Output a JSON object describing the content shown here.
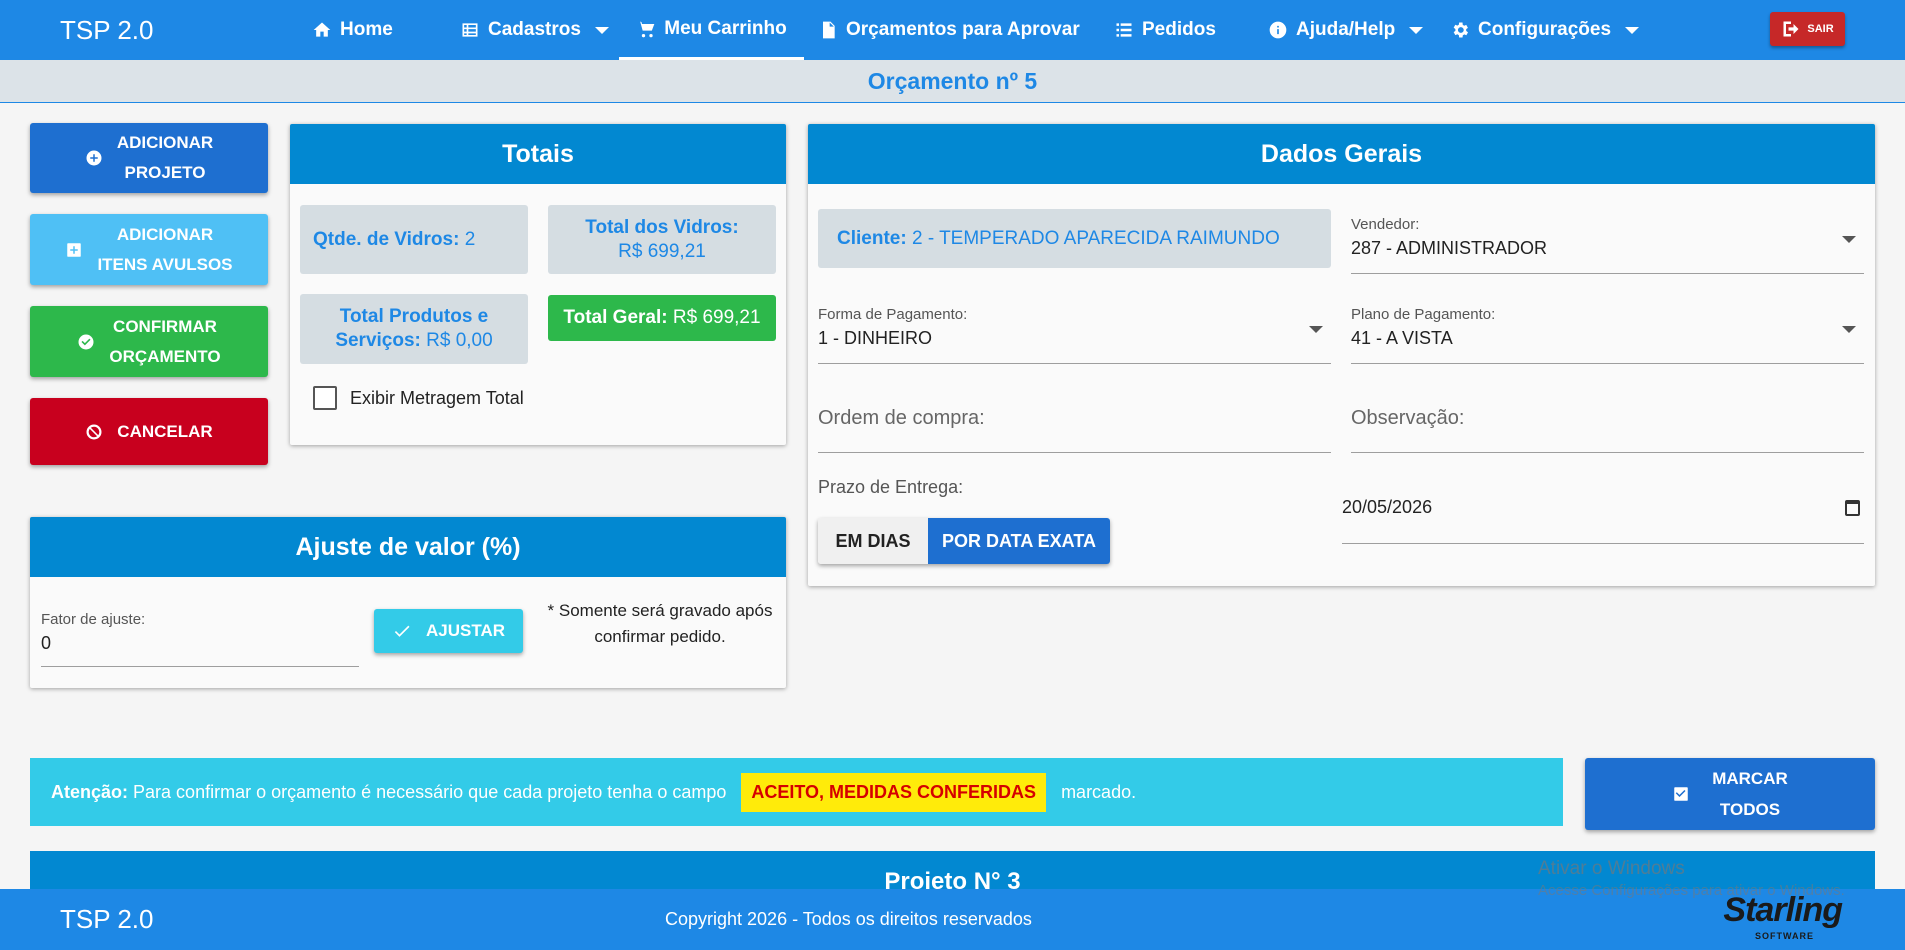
{
  "app": {
    "title": "TSP 2.0"
  },
  "nav": {
    "home": "Home",
    "cadastros": "Cadastros",
    "carrinho": "Meu Carrinho",
    "orcamentos": "Orçamentos para Aprovar",
    "pedidos": "Pedidos",
    "ajuda": "Ajuda/Help",
    "config": "Configurações",
    "sair": "SAIR"
  },
  "page": {
    "title": "Orçamento nº 5"
  },
  "actions": {
    "add_project_1": "ADICIONAR",
    "add_project_2": "PROJETO",
    "add_items_1": "ADICIONAR",
    "add_items_2": "ITENS AVULSOS",
    "confirm_1": "CONFIRMAR",
    "confirm_2": "ORÇAMENTO",
    "cancel": "CANCELAR"
  },
  "totais": {
    "title": "Totais",
    "qtd_label": "Qtde. de Vidros:",
    "qtd_value": "2",
    "vidros_label": "Total dos Vidros:",
    "vidros_value": "R$ 699,21",
    "produtos_label_1": "Total Produtos e",
    "produtos_label_2": "Serviços:",
    "produtos_value": "R$ 0,00",
    "geral_label": "Total Geral:",
    "geral_value": "R$ 699,21",
    "metragem_label": "Exibir Metragem Total",
    "metragem_checked": false
  },
  "ajuste": {
    "title": "Ajuste de valor (%)",
    "fator_label": "Fator de ajuste:",
    "fator_value": "0",
    "button": "AJUSTAR",
    "note_1": "* Somente será gravado após",
    "note_2": "confirmar pedido."
  },
  "dados": {
    "title": "Dados Gerais",
    "cliente_label": "Cliente:",
    "cliente_value": "2 - TEMPERADO APARECIDA RAIMUNDO",
    "vendedor_label": "Vendedor:",
    "vendedor_value": "287 - ADMINISTRADOR",
    "forma_label": "Forma de Pagamento:",
    "forma_value": "1 - DINHEIRO",
    "plano_label": "Plano de Pagamento:",
    "plano_value": "41 - A VISTA",
    "ordem_placeholder": "Ordem de compra:",
    "obs_placeholder": "Observação:",
    "prazo_label": "Prazo de Entrega:",
    "prazo_dias": "EM DIAS",
    "prazo_data": "POR DATA EXATA",
    "date_value": "20/05/2026"
  },
  "warning": {
    "label": "Atenção:",
    "text": "Para confirmar o orçamento é necessário que cada projeto tenha o campo",
    "highlight": "ACEITO, MEDIDAS CONFERIDAS",
    "suffix": "marcado."
  },
  "marcar": {
    "line1": "MARCAR",
    "line2": "TODOS"
  },
  "projeto": {
    "title": "Projeto N° 3"
  },
  "footer": {
    "brand": "TSP 2.0",
    "copyright": "Copyright 2026 - Todos os direitos reservados",
    "logo": "Starling",
    "logo_sub": "SOFTWARE"
  },
  "watermark": {
    "line1": "Ativar o Windows",
    "line2": "Acesse Configurações para ativar o Windows."
  },
  "colors": {
    "primary": "#1e88e5",
    "header": "#0288d1",
    "success": "#2db84b",
    "danger": "#c8001e",
    "info": "#33cbe8",
    "highlight": "#ffeb0a"
  }
}
